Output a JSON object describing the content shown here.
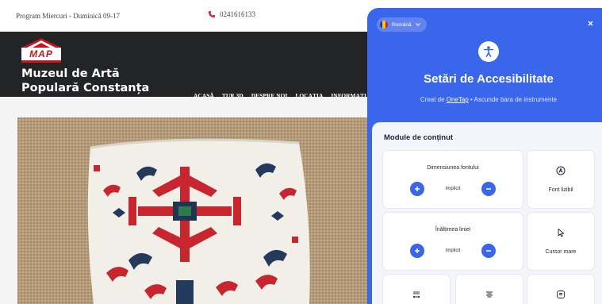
{
  "site": {
    "hours": "Program Miercuri - Duminică 09-17",
    "phone": "0241616133",
    "logo_text": "MAP",
    "name_line1": "Muzeul de Artă",
    "name_line2": "Populară Constanța",
    "nav": [
      "ACASĂ",
      "TUR 3D",
      "DESPRE NOI",
      "LOCAȚIA",
      "INFORMAȚI"
    ]
  },
  "panel": {
    "language": "Română",
    "title": "Setări de Accesibilitate",
    "subtitle_prefix": "Creat de ",
    "subtitle_link": "OneTap",
    "subtitle_suffix": " • Ascunde bara de instrumente",
    "section_title": "Module de conținut",
    "font_size": {
      "label": "Dimensiunea fontului",
      "value": "Implicit"
    },
    "line_height": {
      "label": "Înălțimea liniei",
      "value": "Implicit"
    },
    "readable_font": "Font lizibil",
    "big_cursor": "Cursor mare",
    "accent": "#3a66ec",
    "panel_bg": "#f3f5fb"
  }
}
